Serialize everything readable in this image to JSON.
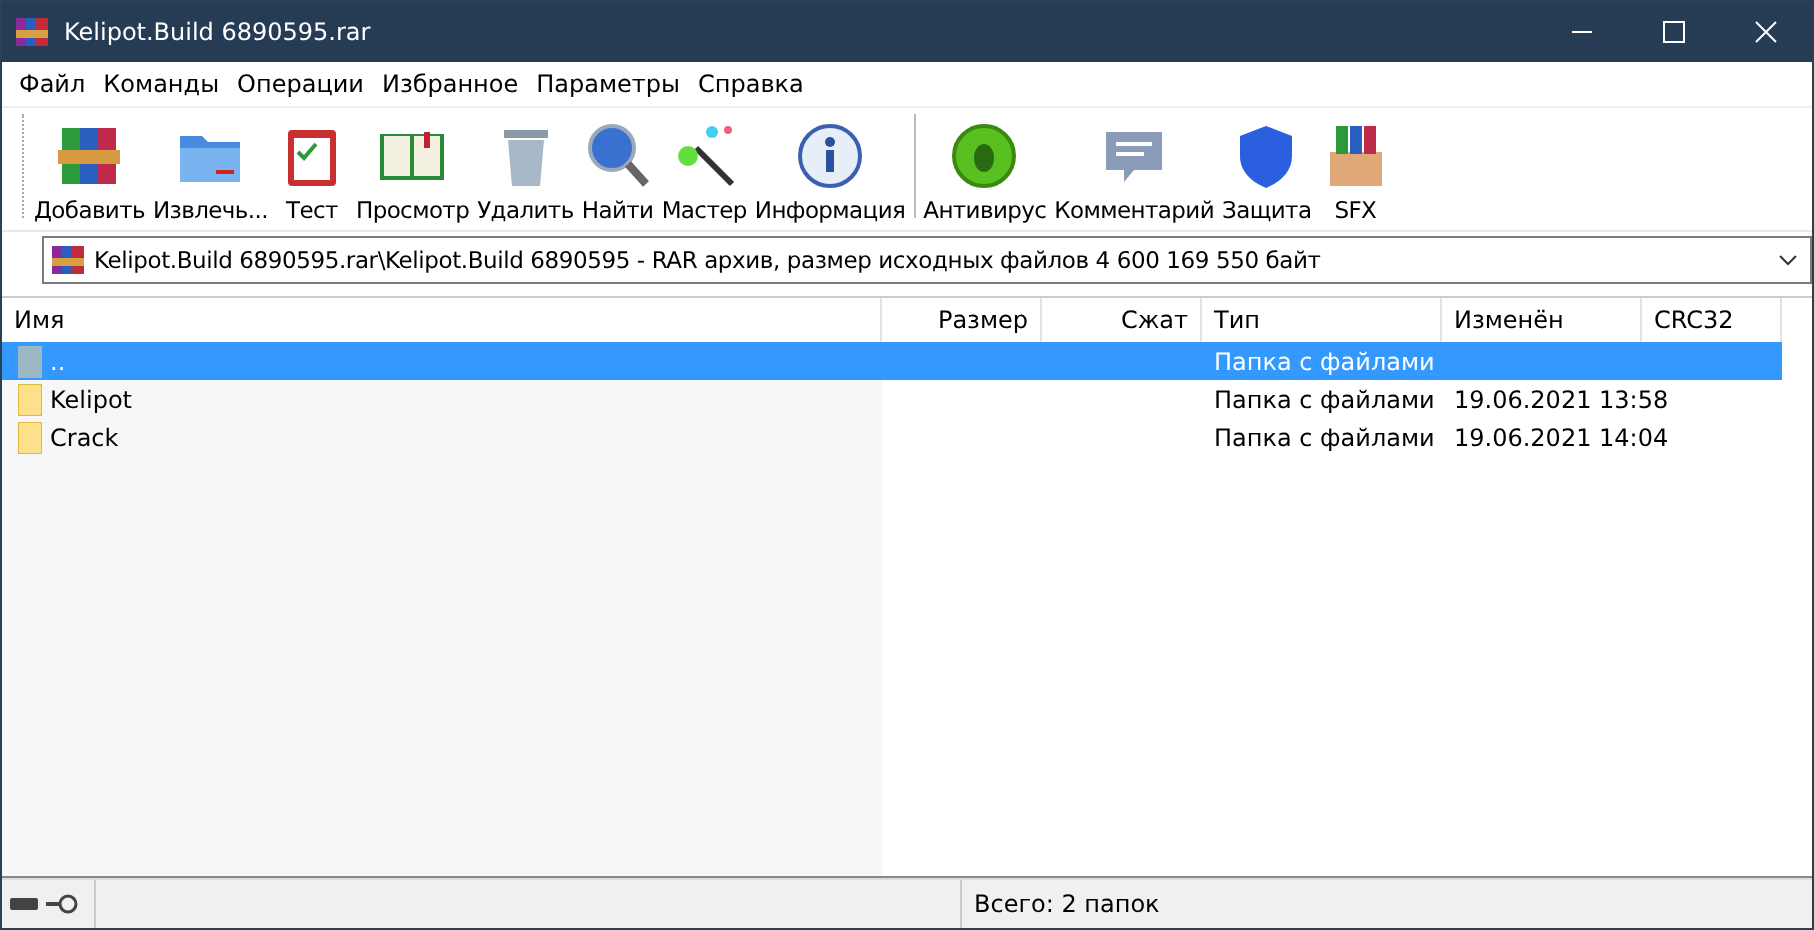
{
  "window": {
    "title": "Kelipot.Build 6890595.rar"
  },
  "menu": [
    "Файл",
    "Команды",
    "Операции",
    "Избранное",
    "Параметры",
    "Справка"
  ],
  "toolbar": [
    {
      "label": "Добавить"
    },
    {
      "label": "Извлечь..."
    },
    {
      "label": "Тест"
    },
    {
      "label": "Просмотр"
    },
    {
      "label": "Удалить"
    },
    {
      "label": "Найти"
    },
    {
      "label": "Мастер"
    },
    {
      "label": "Информация"
    },
    {
      "label": "Антивирус"
    },
    {
      "label": "Комментарий"
    },
    {
      "label": "Защита"
    },
    {
      "label": "SFX"
    }
  ],
  "address": {
    "value": "Kelipot.Build 6890595.rar\\Kelipot.Build 6890595 - RAR архив, размер исходных файлов 4 600 169 550 байт"
  },
  "table": {
    "columns": [
      "Имя",
      "Размер",
      "Сжат",
      "Тип",
      "Изменён",
      "CRC32"
    ],
    "rows": [
      {
        "kind": "parent",
        "name": "..",
        "type": "Папка с файлами",
        "modified": "",
        "selected": true
      },
      {
        "kind": "folder",
        "name": "Kelipot",
        "type": "Папка с файлами",
        "modified": "19.06.2021 13:58",
        "selected": false
      },
      {
        "kind": "folder",
        "name": "Crack",
        "type": "Папка с файлами",
        "modified": "19.06.2021 14:04",
        "selected": false
      }
    ]
  },
  "status_bar": {
    "text": "Всего: 2 папок"
  }
}
